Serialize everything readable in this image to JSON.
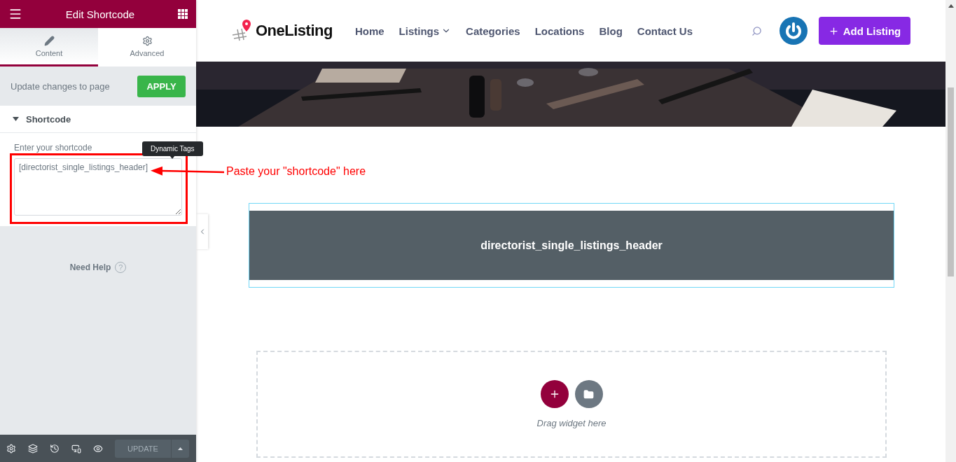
{
  "panel": {
    "title": "Edit Shortcode",
    "tabs": [
      {
        "label": "Content",
        "selected": true,
        "kind": "pencil"
      },
      {
        "label": "Advanced",
        "selected": false,
        "kind": "gear"
      }
    ],
    "apply": {
      "text": "Update changes to page",
      "button": "APPLY"
    },
    "section": {
      "title": "Shortcode",
      "expanded": true,
      "field_label": "Enter your shortcode",
      "value": "[directorist_single_listings_header]",
      "tooltip": "Dynamic Tags"
    },
    "help": {
      "text": "Need Help",
      "icon": "?"
    },
    "footer": {
      "button": "UPDATE"
    }
  },
  "annotation": {
    "text": "Paste your \"shortcode\" here"
  },
  "site": {
    "logo": "OneListing",
    "nav": [
      {
        "label": "Home",
        "has_menu": false
      },
      {
        "label": "Listings",
        "has_menu": true
      },
      {
        "label": "Categories",
        "has_menu": false
      },
      {
        "label": "Locations",
        "has_menu": false
      },
      {
        "label": "Blog",
        "has_menu": false
      },
      {
        "label": "Contact Us",
        "has_menu": false
      }
    ],
    "add_button": "Add Listing"
  },
  "widget": {
    "text": "directorist_single_listings_header"
  },
  "dropzone": {
    "text": "Drag widget here"
  }
}
